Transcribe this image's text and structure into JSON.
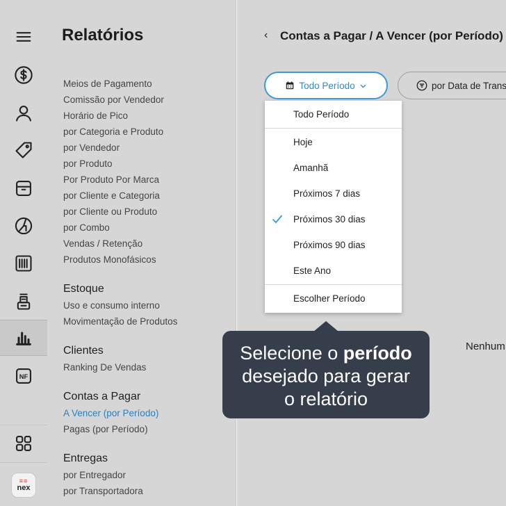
{
  "reports": {
    "title": "Relatórios",
    "top_links": [
      "Meios de Pagamento",
      "Comissão por Vendedor",
      "Horário de Pico",
      "por Categoria e Produto",
      "por Vendedor",
      "por Produto",
      "Por Produto Por Marca",
      "por Cliente e Categoria",
      "por Cliente ou Produto",
      "por Combo",
      "Vendas / Retenção",
      "Produtos Monofásicos"
    ],
    "estoque": {
      "title": "Estoque",
      "links": [
        "Uso e consumo interno",
        "Movimentação de Produtos"
      ]
    },
    "clientes": {
      "title": "Clientes",
      "links": [
        "Ranking De Vendas"
      ]
    },
    "contas": {
      "title": "Contas a Pagar",
      "links": [
        "A Vencer (por Período)",
        "Pagas (por Período)"
      ]
    },
    "entregas": {
      "title": "Entregas",
      "links": [
        "por Entregador",
        "por Transportadora"
      ]
    }
  },
  "header": {
    "back_glyph": "‹",
    "title": "Contas a Pagar / A Vencer (por Período)"
  },
  "toolbar": {
    "period_label": "Todo Período",
    "filter_label": "por Data de Transação"
  },
  "dropdown": {
    "items": [
      "Todo Período",
      "Hoje",
      "Amanhã",
      "Próximos 7 dias",
      "Próximos 30 dias",
      "Próximos 90 dias",
      "Este Ano",
      "Escolher Período"
    ],
    "selected": "Próximos 30 dias"
  },
  "tooltip": {
    "line1_pre": "Selecione o ",
    "line1_bold": "período",
    "line2": "desejado para gerar",
    "line3": "o relatório"
  },
  "empty_text": "Nenhum",
  "logo": {
    "mark": "≡≡",
    "text": "nex"
  },
  "colors": {
    "accent": "#2a8ad0",
    "tooltip_bg": "#353e4a",
    "logo_red": "#d63a3a"
  },
  "icons": [
    "menu-icon",
    "dollar-icon",
    "user-icon",
    "tag-icon",
    "box-icon",
    "pie-chart-icon",
    "barcode-icon",
    "register-icon",
    "bar-chart-icon",
    "nf-icon",
    "apps-grid-icon"
  ]
}
